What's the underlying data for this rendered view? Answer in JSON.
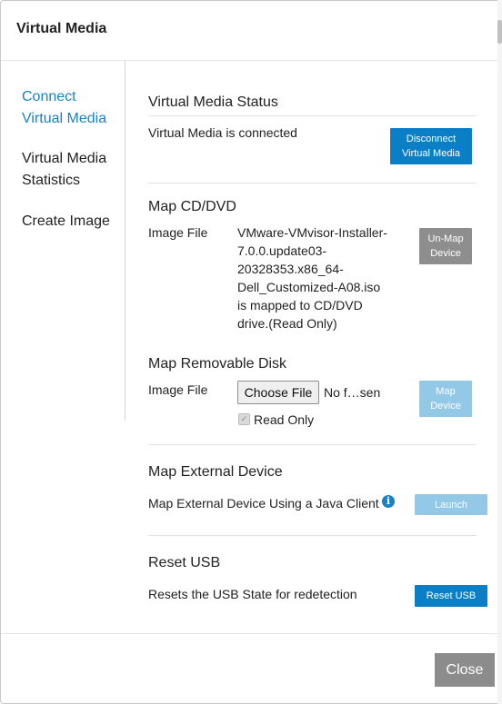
{
  "dialog": {
    "title": "Virtual Media"
  },
  "sidebar": {
    "items": [
      {
        "label": "Connect Virtual Media"
      },
      {
        "label": "Virtual Media Statistics"
      },
      {
        "label": "Create Image"
      }
    ]
  },
  "status": {
    "title": "Virtual Media Status",
    "text": "Virtual Media is connected",
    "button_line1": "Disconnect",
    "button_line2": "Virtual Media"
  },
  "cd": {
    "title": "Map CD/DVD",
    "label": "Image File",
    "lines": [
      "VMware-VMvisor-Installer-",
      "7.0.0.update03-",
      "20328353.x86_64-",
      "Dell_Customized-A08.iso",
      "is mapped to CD/DVD",
      "drive.(Read Only)"
    ],
    "button_line1": "Un-Map",
    "button_line2": "Device"
  },
  "removable": {
    "title": "Map Removable Disk",
    "label": "Image File",
    "choose_label": "Choose File",
    "file_status": "No f…sen",
    "read_only_label": "Read Only",
    "button_line1": "Map",
    "button_line2": "Device"
  },
  "external": {
    "title": "Map External Device",
    "text": "Map External Device Using a Java Client",
    "button": "Launch",
    "icon": "info-icon"
  },
  "reset": {
    "title": "Reset USB",
    "text": "Resets the USB State for redetection",
    "button": "Reset USB"
  },
  "footer": {
    "close_label": "Close"
  },
  "colors": {
    "accent": "#1a82c4",
    "button_blue": "#0b7fc6",
    "button_disabled": "#93c8e6",
    "button_gray": "#8e8e8e"
  }
}
